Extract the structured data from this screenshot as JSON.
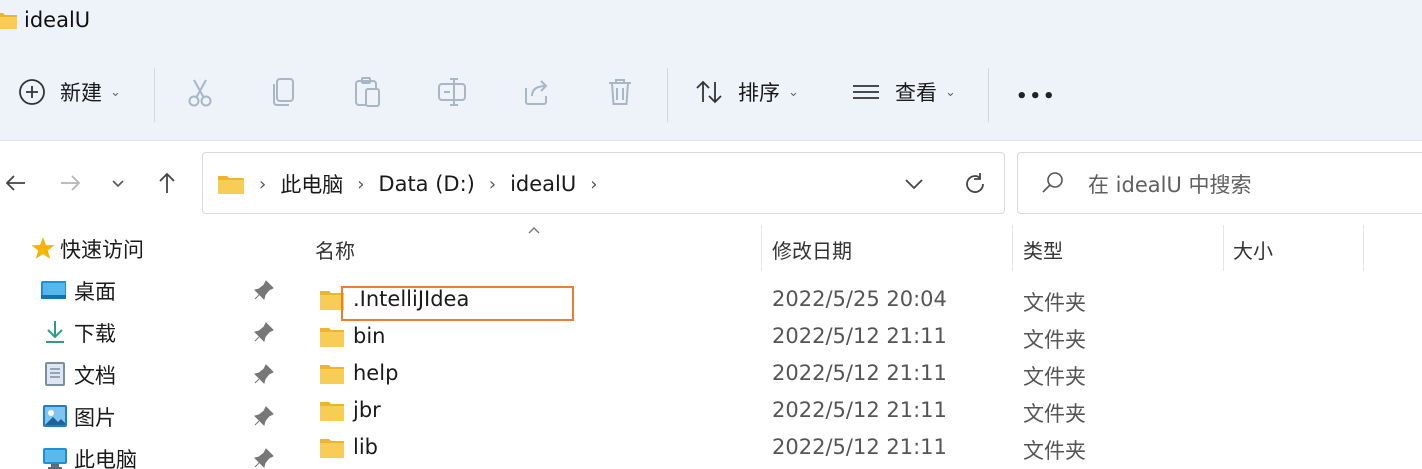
{
  "window": {
    "title": "idealU"
  },
  "toolbar": {
    "new_label": "新建",
    "sort_label": "排序",
    "view_label": "查看",
    "more_label": "•••"
  },
  "nav": {
    "crumbs": [
      "此电脑",
      "Data (D:)",
      "idealU"
    ],
    "search_placeholder": "在 idealU 中搜索"
  },
  "sidebar": {
    "items": [
      {
        "label": "快速访问",
        "icon": "star-icon"
      },
      {
        "label": "桌面",
        "icon": "desktop-icon"
      },
      {
        "label": "下载",
        "icon": "download-icon"
      },
      {
        "label": "文档",
        "icon": "document-icon"
      },
      {
        "label": "图片",
        "icon": "picture-icon"
      },
      {
        "label": "此电脑",
        "icon": "computer-icon"
      }
    ]
  },
  "columns": {
    "name": "名称",
    "modified": "修改日期",
    "type": "类型",
    "size": "大小"
  },
  "files": [
    {
      "name": ".IntelliJIdea",
      "modified": "2022/5/25 20:04",
      "type": "文件夹"
    },
    {
      "name": "bin",
      "modified": "2022/5/12 21:11",
      "type": "文件夹"
    },
    {
      "name": "help",
      "modified": "2022/5/12 21:11",
      "type": "文件夹"
    },
    {
      "name": "jbr",
      "modified": "2022/5/12 21:11",
      "type": "文件夹"
    },
    {
      "name": "lib",
      "modified": "2022/5/12 21:11",
      "type": "文件夹"
    }
  ],
  "colors": {
    "folder": "#f5c242",
    "highlight": "#ed7d31",
    "chrome_bg": "#eef2f9"
  }
}
